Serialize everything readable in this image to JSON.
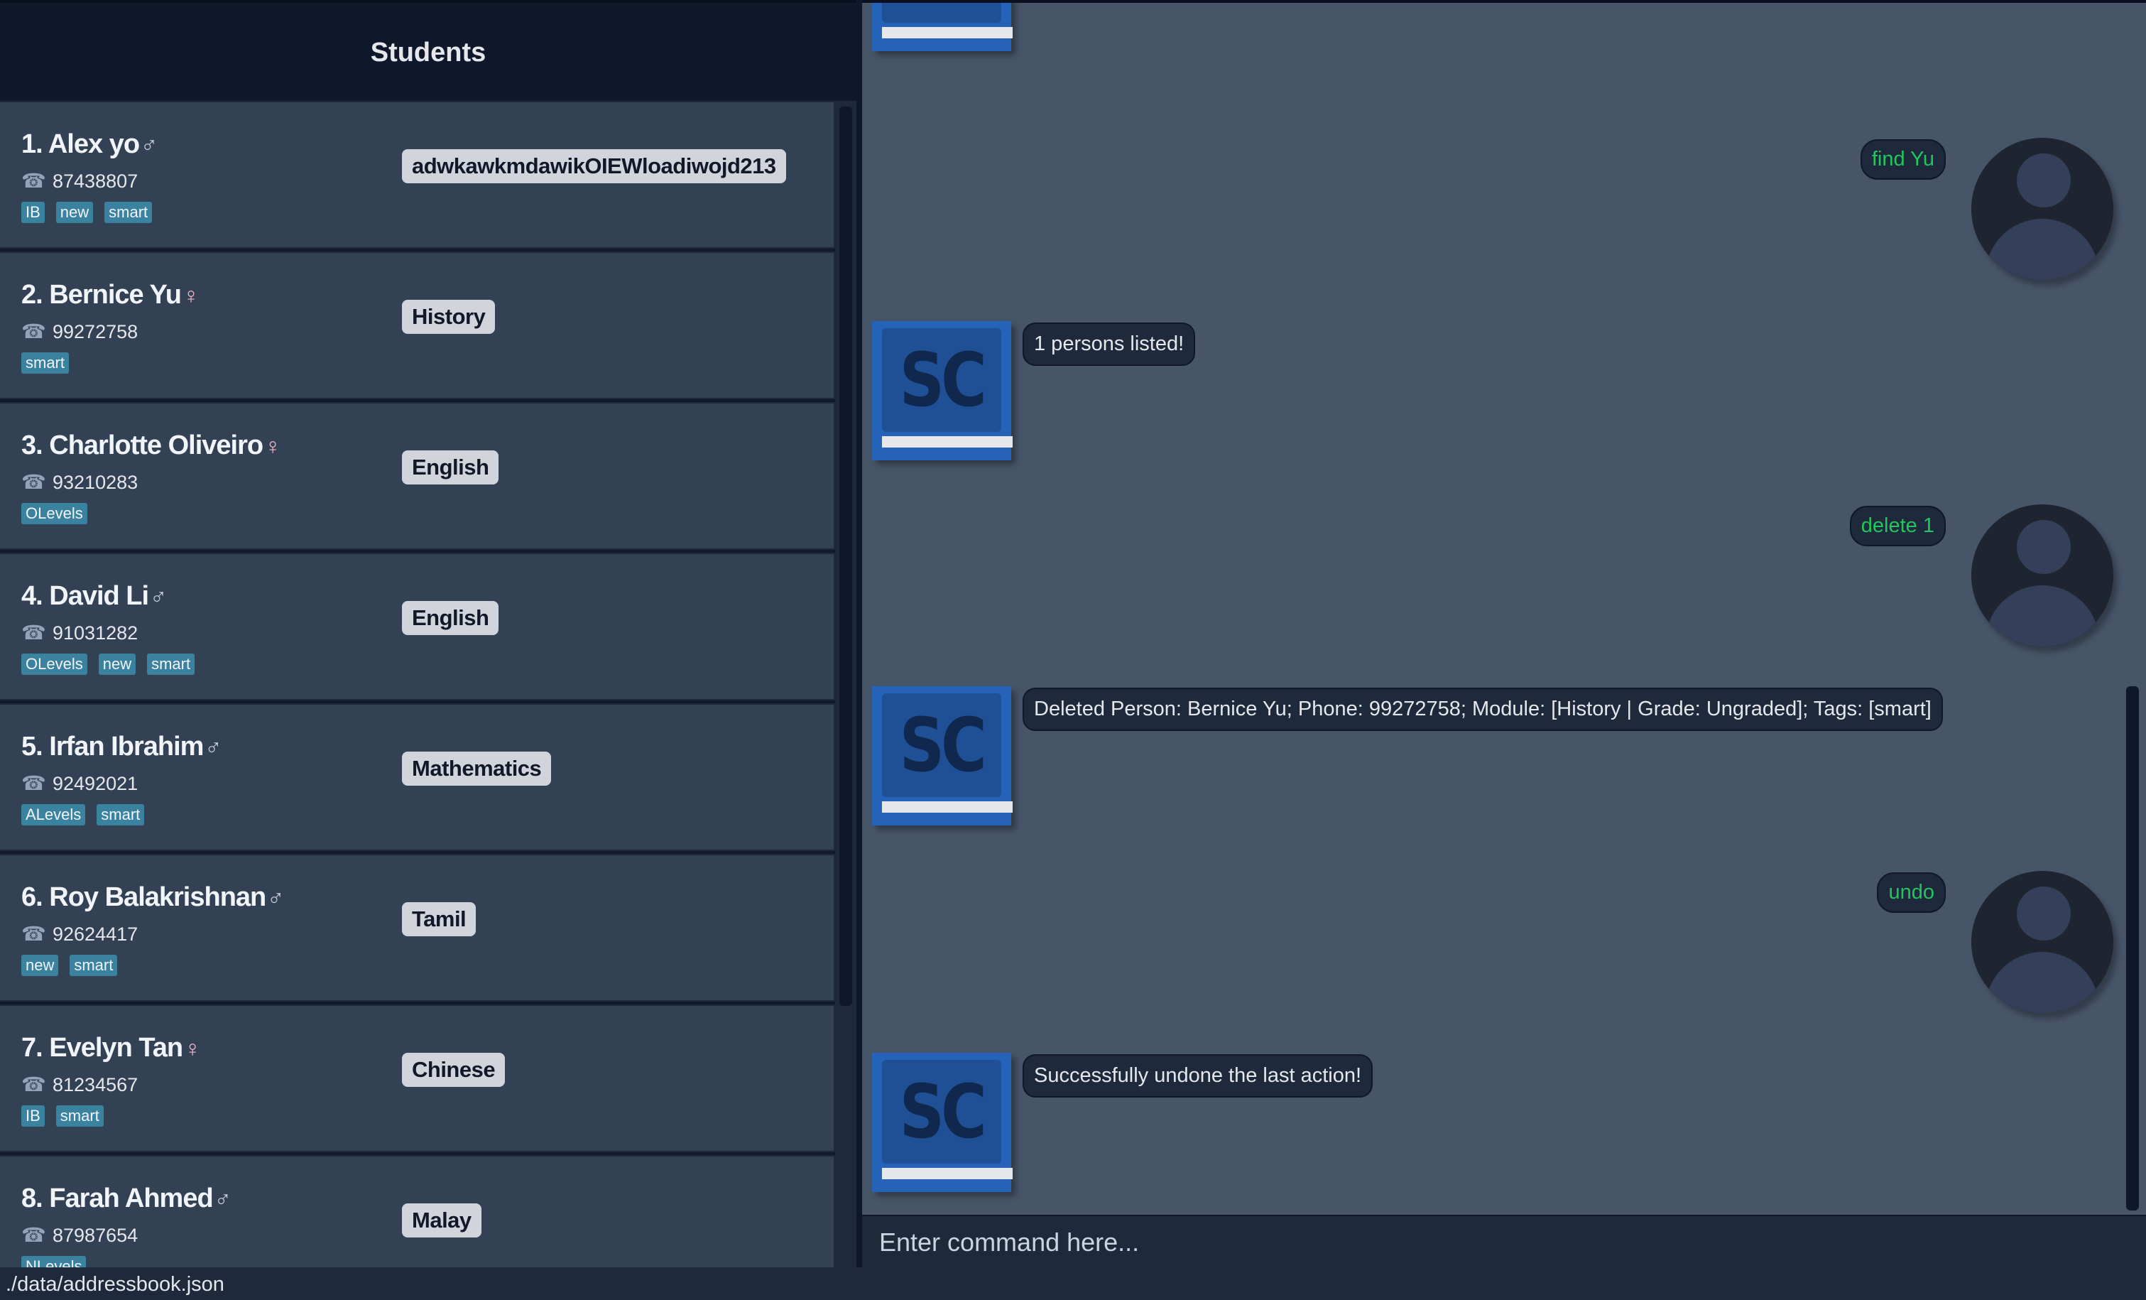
{
  "left_panel": {
    "title": "Students",
    "students": [
      {
        "index": "1.",
        "name": "Alex yo",
        "gender": "♂",
        "gender_type": "m",
        "phone": "87438807",
        "tags": [
          "IB",
          "new",
          "smart"
        ],
        "module": "adwkawkmdawikOIEWloadiwojd213"
      },
      {
        "index": "2.",
        "name": "Bernice Yu",
        "gender": "♀",
        "gender_type": "f",
        "phone": "99272758",
        "tags": [
          "smart"
        ],
        "module": "History"
      },
      {
        "index": "3.",
        "name": "Charlotte Oliveiro",
        "gender": "♀",
        "gender_type": "f",
        "phone": "93210283",
        "tags": [
          "OLevels"
        ],
        "module": "English"
      },
      {
        "index": "4.",
        "name": "David Li",
        "gender": "♂",
        "gender_type": "m",
        "phone": "91031282",
        "tags": [
          "OLevels",
          "new",
          "smart"
        ],
        "module": "English"
      },
      {
        "index": "5.",
        "name": "Irfan Ibrahim",
        "gender": "♂",
        "gender_type": "m",
        "phone": "92492021",
        "tags": [
          "ALevels",
          "smart"
        ],
        "module": "Mathematics"
      },
      {
        "index": "6.",
        "name": "Roy Balakrishnan",
        "gender": "♂",
        "gender_type": "m",
        "phone": "92624417",
        "tags": [
          "new",
          "smart"
        ],
        "module": "Tamil"
      },
      {
        "index": "7.",
        "name": "Evelyn Tan",
        "gender": "♀",
        "gender_type": "f",
        "phone": "81234567",
        "tags": [
          "IB",
          "smart"
        ],
        "module": "Chinese"
      },
      {
        "index": "8.",
        "name": "Farah Ahmed",
        "gender": "♂",
        "gender_type": "m",
        "phone": "87987654",
        "tags": [
          "NLevels"
        ],
        "module": "Malay"
      }
    ]
  },
  "chat": {
    "bot_logo": "SC",
    "messages": [
      {
        "sender": "user",
        "text": "find Yu"
      },
      {
        "sender": "bot",
        "text": "1 persons listed!"
      },
      {
        "sender": "user",
        "text": "delete 1"
      },
      {
        "sender": "bot",
        "text": "Deleted Person: Bernice Yu; Phone: 99272758; Module: [History | Grade: Ungraded]; Tags: [smart]"
      },
      {
        "sender": "user",
        "text": "undo"
      },
      {
        "sender": "bot",
        "text": "Successfully undone the last action!"
      }
    ]
  },
  "command_box": {
    "placeholder": "Enter command here..."
  },
  "status_bar": {
    "path": "./data/addressbook.json"
  },
  "icons": {
    "phone": "phone-icon",
    "user_avatar": "user-avatar-icon",
    "bot_logo": "sc-logo-icon"
  },
  "colors": {
    "user_text": "#22c55e",
    "tag_bg": "#3b82a0",
    "card_bg": "#334155",
    "chat_bg": "#475569",
    "logo_blue": "#2563b8"
  }
}
